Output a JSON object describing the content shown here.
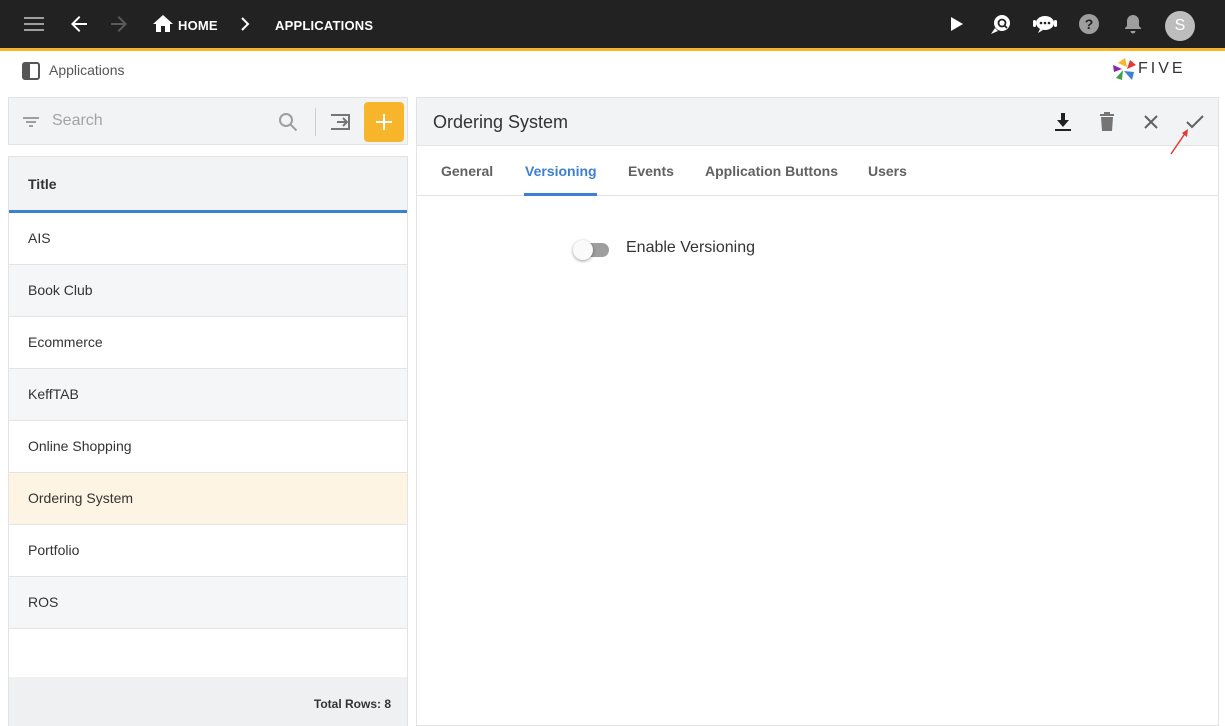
{
  "topbar": {
    "breadcrumb_home": "HOME",
    "breadcrumb_applications": "APPLICATIONS",
    "avatar_initial": "S",
    "accent_color": "#f7b52c"
  },
  "subheader": {
    "title": "Applications",
    "logo_text": "FIVE"
  },
  "search": {
    "placeholder": "Search"
  },
  "list": {
    "column_title": "Title",
    "rows": [
      "AIS",
      "Book Club",
      "Ecommerce",
      "KeffTAB",
      "Online Shopping",
      "Ordering System",
      "Portfolio",
      "ROS"
    ],
    "selected": "Ordering System",
    "footer": "Total Rows: 8"
  },
  "detail": {
    "title": "Ordering System",
    "tabs": [
      "General",
      "Versioning",
      "Events",
      "Application Buttons",
      "Users"
    ],
    "active_tab": "Versioning",
    "toggle_label": "Enable Versioning",
    "toggle_on": false,
    "tab_color": "#3d7fd1"
  }
}
